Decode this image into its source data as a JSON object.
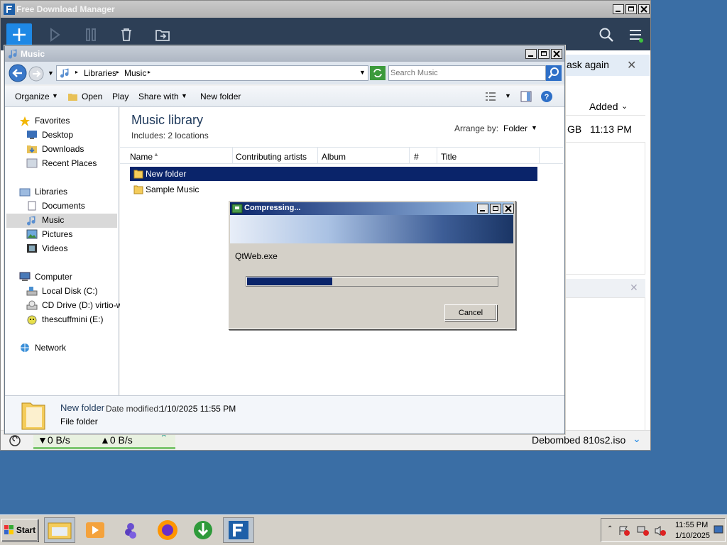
{
  "fdm": {
    "title": "Free Download Manager",
    "ask_again": "ask again",
    "added_header": "Added",
    "row_size_tail": "GB",
    "row_added": "11:13 PM",
    "download_speed": "▼0 B/s",
    "upload_speed": "▲0 B/s",
    "status_file": "Debombed 810s2.iso"
  },
  "explorer": {
    "title": "Music",
    "breadcrumb": [
      "Libraries",
      "Music"
    ],
    "search_placeholder": "Search Music",
    "toolbar": {
      "organize": "Organize",
      "open": "Open",
      "play": "Play",
      "share_with": "Share with",
      "new_folder": "New folder"
    },
    "nav": {
      "favorites": "Favorites",
      "desktop": "Desktop",
      "downloads": "Downloads",
      "recent_places": "Recent Places",
      "libraries": "Libraries",
      "documents": "Documents",
      "music": "Music",
      "pictures": "Pictures",
      "videos": "Videos",
      "computer": "Computer",
      "local_disk": "Local Disk (C:)",
      "cd_drive": "CD Drive (D:) virtio-wi",
      "thescuffmini": "thescuffmini (E:)",
      "network": "Network"
    },
    "library": {
      "title": "Music library",
      "includes": "Includes:  2 locations",
      "arrange_by_label": "Arrange by:",
      "arrange_by_value": "Folder"
    },
    "columns": [
      "Name",
      "Contributing artists",
      "Album",
      "#",
      "Title"
    ],
    "items": [
      {
        "name": "New folder",
        "selected": true
      },
      {
        "name": "Sample Music",
        "selected": false
      }
    ],
    "details": {
      "name": "New folder",
      "date_modified_label": "Date modified:",
      "date_modified": "1/10/2025 11:55 PM",
      "type": "File folder"
    }
  },
  "compress_dialog": {
    "title": "Compressing...",
    "file": "QtWeb.exe",
    "progress": 0.34,
    "cancel": "Cancel"
  },
  "taskbar": {
    "start": "Start",
    "time": "11:55 PM",
    "date": "1/10/2025"
  }
}
